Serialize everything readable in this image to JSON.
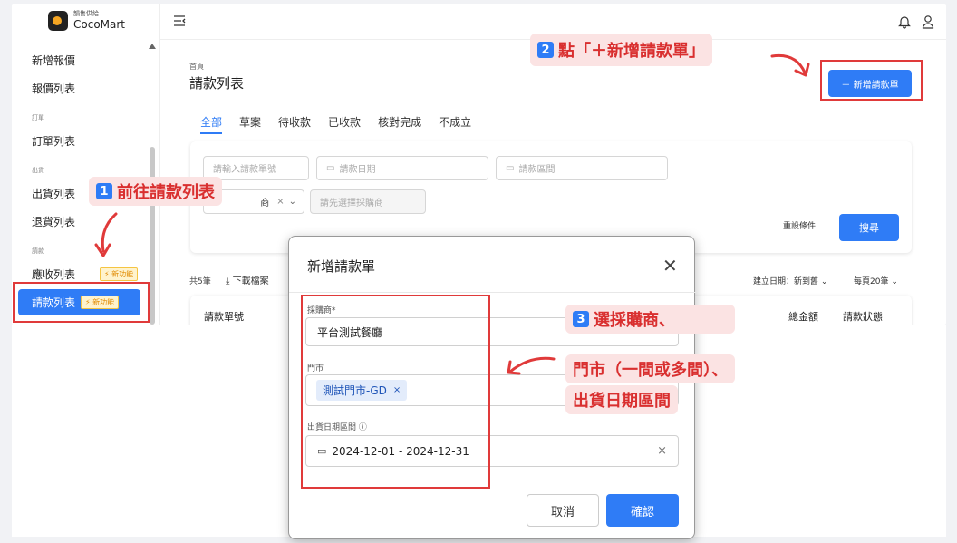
{
  "logo": {
    "small": "韻售供給",
    "big": "CocoMart"
  },
  "sidebar": {
    "items": [
      {
        "label": "新增報價"
      },
      {
        "label": "報價列表"
      },
      {
        "group": "訂單"
      },
      {
        "label": "訂單列表"
      },
      {
        "group": "出貨"
      },
      {
        "label": "出貨列表"
      },
      {
        "label": "退貨列表"
      },
      {
        "group": "請款"
      },
      {
        "label": "應收列表",
        "badge": "新功能"
      },
      {
        "label": "請款列表",
        "badge": "新功能",
        "active": true
      }
    ]
  },
  "main": {
    "breadcrumb": "首頁",
    "title": "請款列表",
    "add_button": "＋ 新增請款單",
    "tabs": [
      "全部",
      "草案",
      "待收款",
      "已收款",
      "核對完成",
      "不成立"
    ],
    "filters": {
      "number_placeholder": "請輸入請款單號",
      "date_placeholder": "請款日期",
      "range_placeholder": "請款區間",
      "vendor_partial": "商",
      "store_placeholder": "請先選擇採購商",
      "reset": "重設條件",
      "search": "搜尋"
    },
    "count": "共5筆",
    "download": "下載檔案",
    "sort": "建立日期：新到舊",
    "page_size": "每頁20筆",
    "columns": [
      "請款單號",
      "總金額",
      "請款狀態"
    ]
  },
  "modal": {
    "title": "新增請款單",
    "vendor_label": "採購商*",
    "vendor_value": "平台測試餐廳",
    "store_label": "門市",
    "store_chip": "測試門市-GD",
    "date_label": "出貨日期區間",
    "date_value": "2024-12-01 - 2024-12-31",
    "cancel": "取消",
    "confirm": "確認"
  },
  "annotations": {
    "step1_num": "1",
    "step1": "前往請款列表",
    "step2_num": "2",
    "step2": "點「＋新增請款單」",
    "step3_num": "3",
    "step3_line1": "選採購商、",
    "step3_line2": "門市（一間或多間）、",
    "step3_line3": "出貨日期區間"
  },
  "colors": {
    "accent": "#2f7cf6",
    "annotation": "#e03a3a",
    "callout_bg": "#fbe3e3"
  }
}
